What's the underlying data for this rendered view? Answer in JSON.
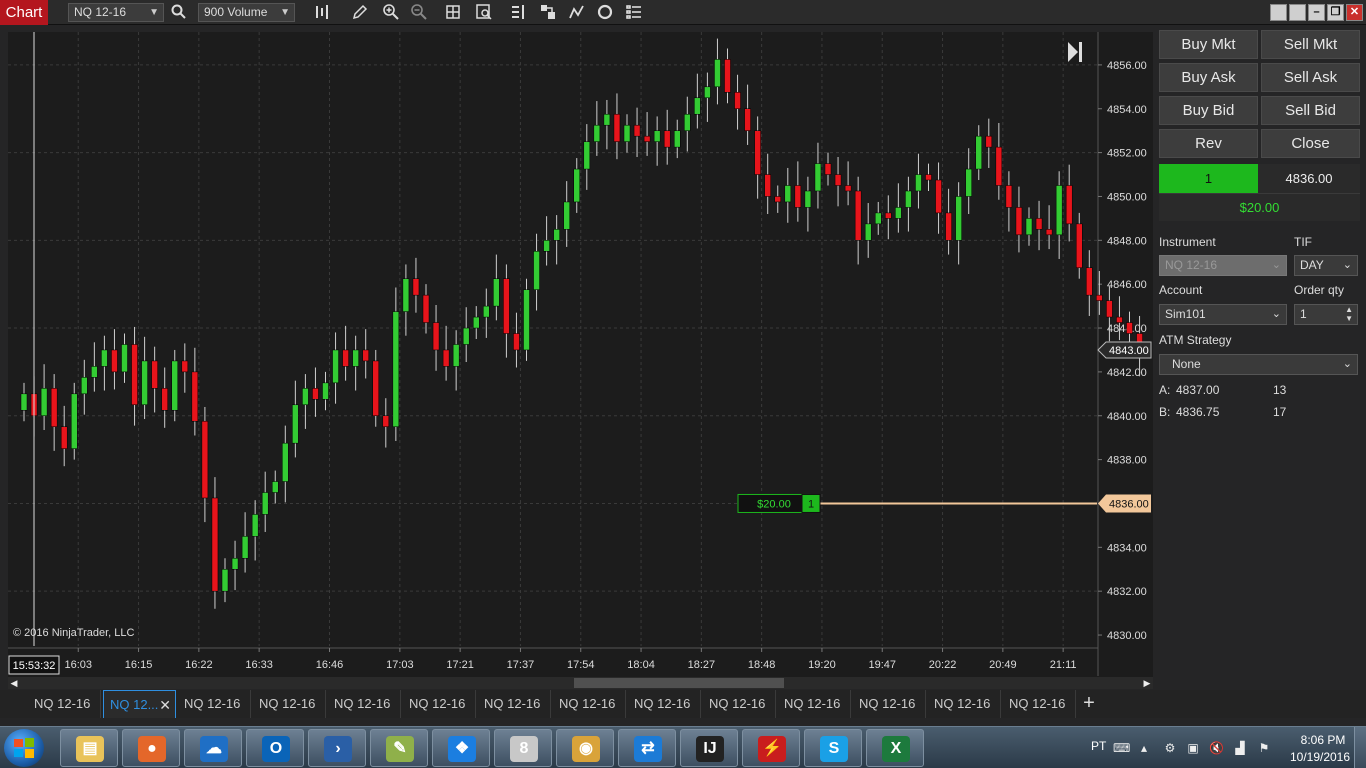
{
  "toolbar": {
    "chart_tab": "Chart",
    "instrument": "NQ 12-16",
    "period": "900 Volume",
    "icons": [
      "search-icon",
      "bar-type-icon",
      "draw-pencil-icon",
      "zoom-in-icon",
      "zoom-out-icon",
      "crosshair-icon",
      "data-box-icon",
      "indicators-icon",
      "strategies-icon",
      "drawing-tools-icon",
      "reload-icon",
      "properties-icon"
    ]
  },
  "chart": {
    "copyright": "© 2016 NinjaTrader, LLC",
    "current_time_label": "15:53:32",
    "last_price_label": "4843.00",
    "position_price_label": "4836.00",
    "position_pnl": "$20.00",
    "position_qty": "1"
  },
  "chart_data": {
    "type": "candlestick",
    "instrument": "NQ 12-16",
    "period": "900 Volume",
    "ylim": [
      4829.5,
      4857.5
    ],
    "y_ticks": [
      "4856.00",
      "4854.00",
      "4852.00",
      "4850.00",
      "4848.00",
      "4846.00",
      "4844.00",
      "4842.00",
      "4840.00",
      "4838.00",
      "4836.00",
      "4834.00",
      "4832.00",
      "4830.00"
    ],
    "x_ticks": [
      "16:03",
      "16:15",
      "16:22",
      "16:33",
      "16:46",
      "17:03",
      "17:21",
      "17:37",
      "17:54",
      "18:04",
      "18:27",
      "18:48",
      "19:20",
      "19:47",
      "20:22",
      "20:49",
      "21:11"
    ],
    "closes": [
      4841.0,
      4840.0,
      4841.25,
      4839.5,
      4838.5,
      4841.0,
      4841.75,
      4842.25,
      4843.0,
      4842.0,
      4843.25,
      4840.5,
      4842.5,
      4841.25,
      4840.25,
      4842.5,
      4842.0,
      4839.75,
      4836.25,
      4832.0,
      4833.0,
      4833.5,
      4834.5,
      4835.5,
      4836.5,
      4837.0,
      4838.75,
      4840.5,
      4841.25,
      4840.75,
      4841.5,
      4843.0,
      4842.25,
      4843.0,
      4842.5,
      4840.0,
      4839.5,
      4844.75,
      4846.25,
      4845.5,
      4844.25,
      4843.0,
      4842.25,
      4843.25,
      4844.0,
      4844.5,
      4845.0,
      4846.25,
      4843.75,
      4843.0,
      4845.75,
      4847.5,
      4848.0,
      4848.5,
      4849.75,
      4851.25,
      4852.5,
      4853.25,
      4853.75,
      4852.5,
      4853.25,
      4852.75,
      4852.5,
      4853.0,
      4852.25,
      4853.0,
      4853.75,
      4854.5,
      4855.0,
      4856.25,
      4854.75,
      4854.0,
      4853.0,
      4851.0,
      4850.0,
      4849.75,
      4850.5,
      4849.5,
      4850.25,
      4851.5,
      4851.0,
      4850.5,
      4850.25,
      4848.0,
      4848.75,
      4849.25,
      4849.0,
      4849.5,
      4850.25,
      4851.0,
      4850.75,
      4849.25,
      4848.0,
      4850.0,
      4851.25,
      4852.75,
      4852.25,
      4850.5,
      4849.5,
      4848.25,
      4849.0,
      4848.5,
      4848.25,
      4850.5,
      4848.75,
      4846.75,
      4845.5,
      4845.25,
      4844.5,
      4844.25,
      4843.75,
      4842.75
    ]
  },
  "panel": {
    "buy_mkt": "Buy Mkt",
    "sell_mkt": "Sell Mkt",
    "buy_ask": "Buy Ask",
    "sell_ask": "Sell Ask",
    "buy_bid": "Buy Bid",
    "sell_bid": "Sell Bid",
    "rev": "Rev",
    "close": "Close",
    "position_qty": "1",
    "position_price": "4836.00",
    "unrealized": "$20.00",
    "instrument_label": "Instrument",
    "instrument_value": "NQ 12-16",
    "tif_label": "TIF",
    "tif_value": "DAY",
    "account_label": "Account",
    "account_value": "Sim101",
    "order_qty_label": "Order qty",
    "order_qty_value": "1",
    "atm_label": "ATM Strategy",
    "atm_value": "None",
    "ask_label": "A:",
    "ask_price": "4837.00",
    "ask_size": "13",
    "bid_label": "B:",
    "bid_price": "4836.75",
    "bid_size": "17"
  },
  "tabs": [
    "NQ 12-16",
    "NQ 12...",
    "NQ 12-16",
    "NQ 12-16",
    "NQ 12-16",
    "NQ 12-16",
    "NQ 12-16",
    "NQ 12-16",
    "NQ 12-16",
    "NQ 12-16",
    "NQ 12-16",
    "NQ 12-16",
    "NQ 12-16",
    "NQ 12-16"
  ],
  "active_tab": 1,
  "taskbar": {
    "apps": [
      "file-explorer",
      "firefox",
      "onedrive",
      "outlook",
      "powershell",
      "notepad",
      "dropbox",
      "ninjatrader",
      "chrome",
      "teamviewer",
      "intellij",
      "acrobat",
      "skype",
      "excel"
    ],
    "language": "PT",
    "time": "8:06 PM",
    "date": "10/19/2016"
  },
  "colors": {
    "up": "#33cc33",
    "down": "#e8141b",
    "chart_bg": "#1c1c1c",
    "position_line": "#f2c79a"
  }
}
